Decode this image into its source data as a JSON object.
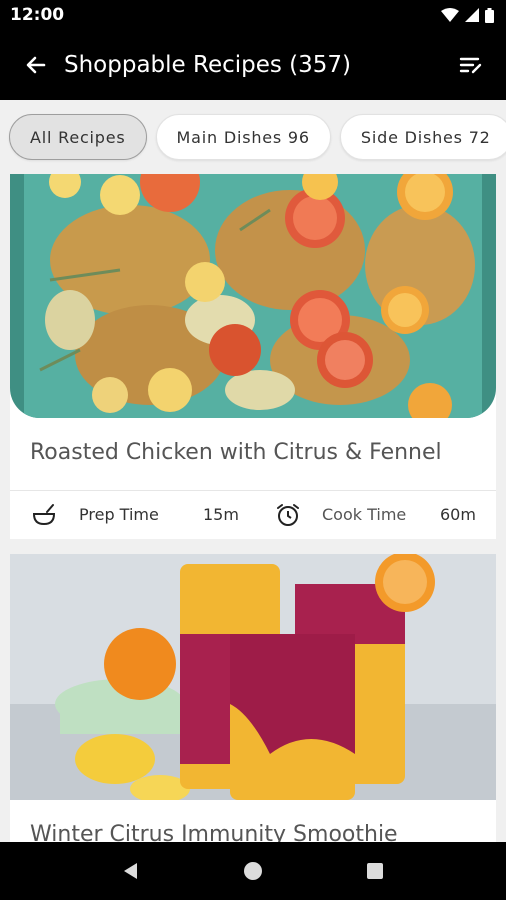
{
  "status_bar": {
    "time": "12:00"
  },
  "app_bar": {
    "title": "Shoppable Recipes (357)"
  },
  "filters": [
    {
      "label": "All Recipes"
    },
    {
      "label": "Main Dishes 96"
    },
    {
      "label": "Side Dishes 72"
    }
  ],
  "recipes": [
    {
      "title": "Roasted Chicken with Citrus & Fennel",
      "prep_label": "Prep Time",
      "prep_value": "15m",
      "cook_label": "Cook Time",
      "cook_value": "60m"
    },
    {
      "title": "Winter Citrus Immunity Smoothie"
    }
  ],
  "colors": {
    "bar_black": "#000000",
    "platter_teal": "#4fa79a",
    "chicken_gold": "#c89a4c",
    "smoothie_yellow": "#f2b632",
    "smoothie_magenta": "#a8214e"
  }
}
